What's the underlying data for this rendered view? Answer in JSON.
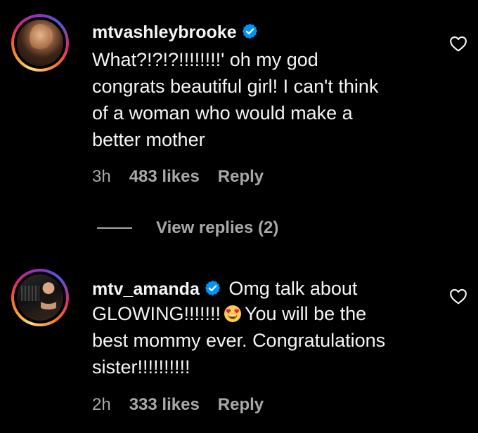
{
  "comments": [
    {
      "username": "mtvashleybrooke",
      "verified": true,
      "text_lines": [
        "What?!?!?!!!!!!!!' oh my god",
        "congrats beautiful girl! I can't think",
        "of a woman who would make a",
        "better mother"
      ],
      "time": "3h",
      "likes": "483 likes",
      "reply_label": "Reply",
      "view_replies_label": "View replies (2)",
      "like_icon": "heart-outline-icon"
    },
    {
      "username": "mtv_amanda",
      "verified": true,
      "text_first_line": "Omg talk about",
      "text_second_line_before_emoji": "GLOWING!!!!!!!",
      "emoji": "heart-eyes-emoji",
      "text_second_line_after_emoji": "You will be the",
      "text_lines_rest": [
        "best mommy ever. Congratulations",
        "sister!!!!!!!!!!"
      ],
      "time": "2h",
      "likes": "333 likes",
      "reply_label": "Reply",
      "like_icon": "heart-outline-icon"
    }
  ],
  "colors": {
    "background": "#000000",
    "primary_text": "#f5f5f5",
    "secondary_text": "#a8a8a8",
    "verified_badge": "#0095f6"
  }
}
